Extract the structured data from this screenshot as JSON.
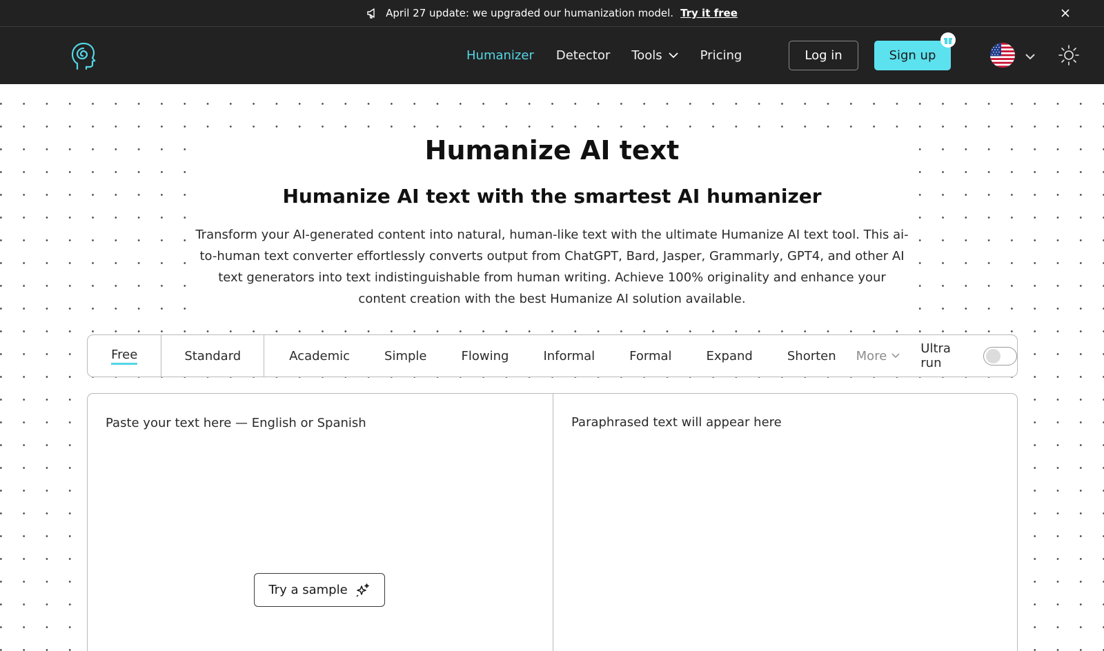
{
  "announcement": {
    "text": "April 27 update: we upgraded our humanization model.",
    "cta": "Try it free",
    "icon": "megaphone-icon"
  },
  "nav": {
    "links": [
      {
        "label": "Humanizer",
        "active": true
      },
      {
        "label": "Detector",
        "active": false
      },
      {
        "label": "Tools",
        "active": false,
        "dropdown": true
      },
      {
        "label": "Pricing",
        "active": false
      }
    ],
    "login": "Log in",
    "signup": "Sign up",
    "accent": "#5ce1ee",
    "active_color": "#54d6e6"
  },
  "hero": {
    "title": "Humanize AI text",
    "subtitle": "Humanize AI text with the smartest AI humanizer",
    "description": "Transform your AI-generated content into natural, human-like text with the ultimate Humanize AI text tool. This ai-to-human text converter effortlessly converts output from ChatGPT, Bard, Jasper, Grammarly, GPT4, and other AI text generators into text indistinguishable from human writing. Achieve 100% originality and enhance your content creation with the best Humanize AI solution available."
  },
  "modes": {
    "items": [
      "Free",
      "Standard",
      "Academic",
      "Simple",
      "Flowing",
      "Informal",
      "Formal",
      "Expand",
      "Shorten"
    ],
    "selected": "Free",
    "more": "More",
    "ultra_label": "Ultra run",
    "ultra_enabled": false
  },
  "editor": {
    "input_placeholder": "Paste your text here — English or Spanish",
    "output_placeholder": "Paraphrased text will appear here",
    "sample_button": "Try a sample"
  }
}
